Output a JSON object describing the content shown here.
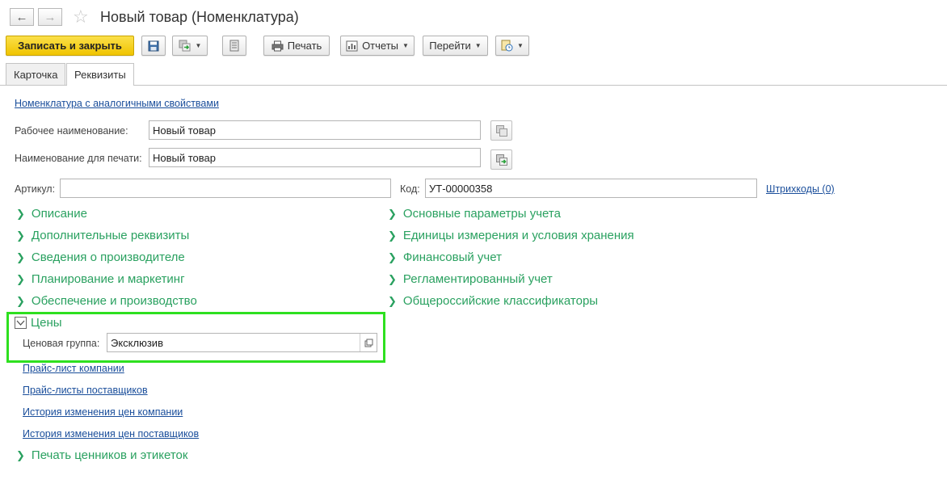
{
  "window": {
    "title": "Новый товар (Номенклатура)"
  },
  "toolbar": {
    "save_close_label": "Записать и закрыть",
    "print_label": "Печать",
    "reports_label": "Отчеты",
    "goto_label": "Перейти"
  },
  "tabs": [
    {
      "label": "Карточка",
      "active": false
    },
    {
      "label": "Реквизиты",
      "active": true
    }
  ],
  "form": {
    "analog_link": "Номенклатура с аналогичными свойствами",
    "working_name_label": "Рабочее наименование:",
    "working_name_value": "Новый товар",
    "print_name_label": "Наименование для печати:",
    "print_name_value": "Новый товар",
    "article_label": "Артикул:",
    "article_value": "",
    "code_label": "Код:",
    "code_value": "УТ-00000358",
    "barcodes_link": "Штрихкоды (0)"
  },
  "groups_left": [
    "Описание",
    "Дополнительные реквизиты",
    "Сведения о производителе",
    "Планирование и маркетинг",
    "Обеспечение и производство"
  ],
  "groups_right": [
    "Основные параметры учета",
    "Единицы измерения и условия хранения",
    "Финансовый учет",
    "Регламентированный учет",
    "Общероссийские классификаторы"
  ],
  "prices": {
    "title": "Цены",
    "price_group_label": "Ценовая группа:",
    "price_group_value": "Эксклюзив",
    "links": [
      "Прайс-лист компании",
      "Прайс-листы поставщиков",
      "История изменения цен компании",
      "История изменения цен поставщиков"
    ]
  },
  "labels_group": "Печать ценников и этикеток",
  "colors": {
    "accent_green": "#2aa160",
    "link_blue": "#1a4e9b",
    "primary_yellow": "#f5d21c",
    "highlight_green": "#2ee01f"
  }
}
